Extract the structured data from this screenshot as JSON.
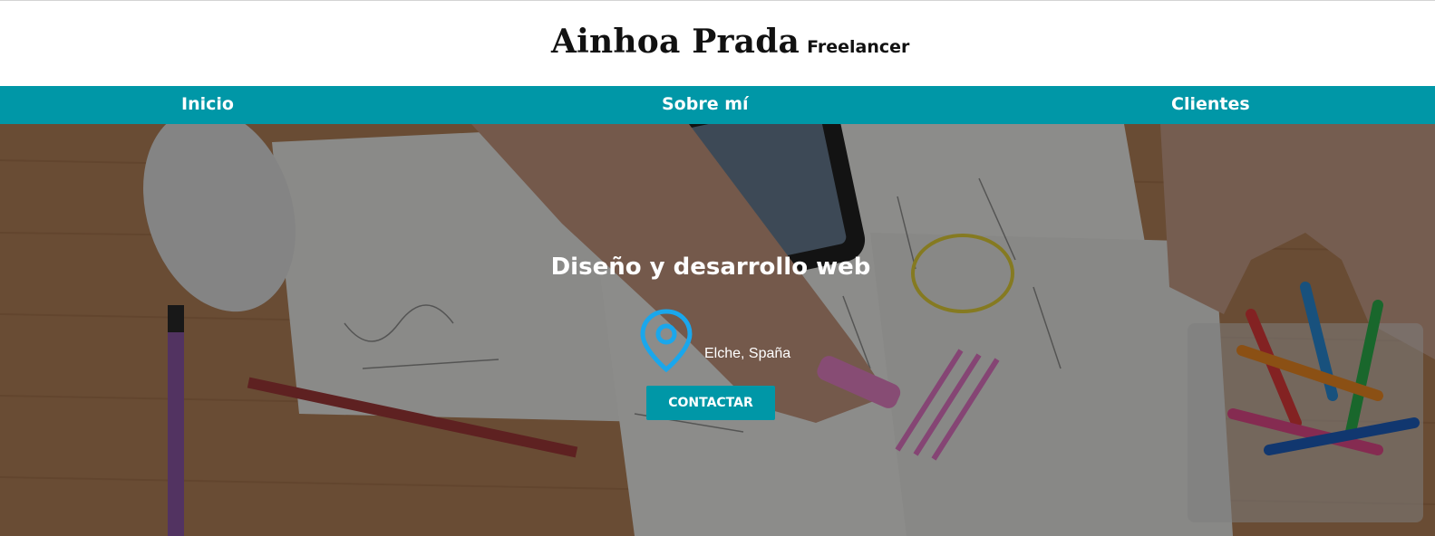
{
  "header": {
    "name": "Ainhoa Prada",
    "subtitle": "Freelancer"
  },
  "nav": {
    "items": [
      {
        "label": "Inicio"
      },
      {
        "label": "Sobre mí"
      },
      {
        "label": "Clientes"
      }
    ]
  },
  "hero": {
    "title": "Diseño y desarrollo web",
    "location": "Elche, Spaña",
    "cta_label": "CONTACTAR",
    "pin_icon": "location-pin-icon"
  },
  "colors": {
    "accent": "#0097a7",
    "pin": "#1aa7ec",
    "wood": "#b0805a"
  }
}
